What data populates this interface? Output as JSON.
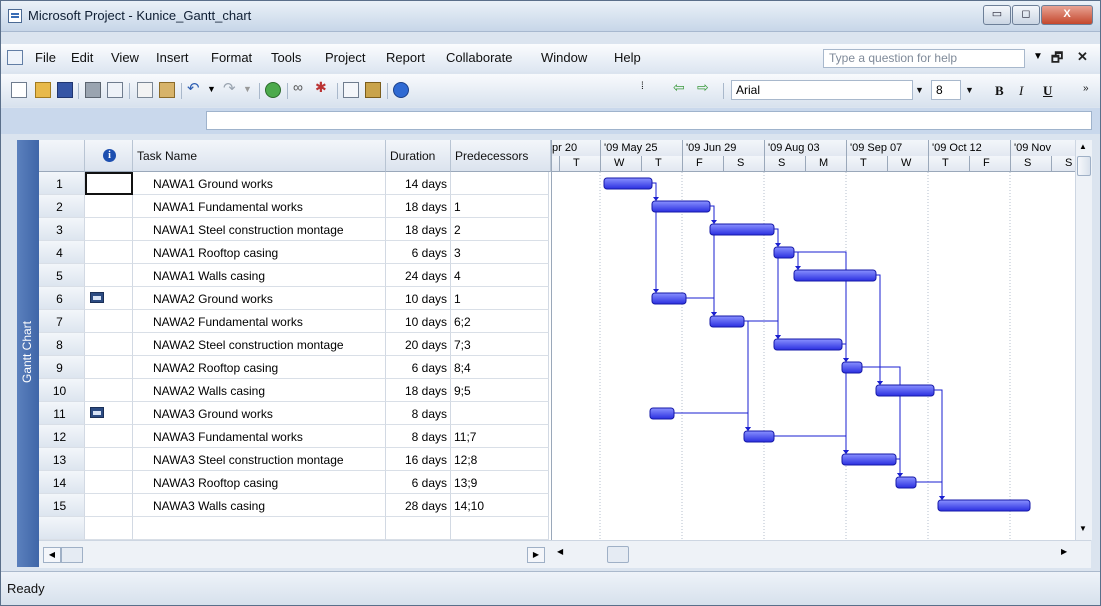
{
  "window": {
    "title": "Microsoft Project - Kunice_Gantt_chart",
    "minimize": "▭",
    "maximize": "◻",
    "close": "X"
  },
  "menu": {
    "items": [
      "File",
      "Edit",
      "View",
      "Insert",
      "Format",
      "Tools",
      "Project",
      "Report",
      "Collaborate",
      "Window",
      "Help"
    ],
    "help_placeholder": "Type a question for help"
  },
  "toolbar": {
    "font": "Arial",
    "font_size": "8",
    "bold": "B",
    "italic": "I",
    "underline": "U"
  },
  "viewbar": {
    "label": "Gantt Chart"
  },
  "table": {
    "columns": [
      "",
      "",
      "Task Name",
      "Duration",
      "Predecessors"
    ],
    "rows": [
      {
        "id": "1",
        "name": "NAWA1 Ground works",
        "duration": "14 days",
        "pred": "",
        "indicator": ""
      },
      {
        "id": "2",
        "name": "NAWA1 Fundamental works",
        "duration": "18 days",
        "pred": "1",
        "indicator": ""
      },
      {
        "id": "3",
        "name": "NAWA1 Steel construction montage",
        "duration": "18 days",
        "pred": "2",
        "indicator": ""
      },
      {
        "id": "4",
        "name": "NAWA1 Rooftop casing",
        "duration": "6 days",
        "pred": "3",
        "indicator": ""
      },
      {
        "id": "5",
        "name": "NAWA1 Walls casing",
        "duration": "24 days",
        "pred": "4",
        "indicator": ""
      },
      {
        "id": "6",
        "name": "NAWA2 Ground works",
        "duration": "10 days",
        "pred": "1",
        "indicator": "calendar-icon"
      },
      {
        "id": "7",
        "name": "NAWA2 Fundamental works",
        "duration": "10 days",
        "pred": "6;2",
        "indicator": ""
      },
      {
        "id": "8",
        "name": "NAWA2 Steel construction montage",
        "duration": "20 days",
        "pred": "7;3",
        "indicator": ""
      },
      {
        "id": "9",
        "name": "NAWA2 Rooftop casing",
        "duration": "6 days",
        "pred": "8;4",
        "indicator": ""
      },
      {
        "id": "10",
        "name": "NAWA2 Walls casing",
        "duration": "18 days",
        "pred": "9;5",
        "indicator": ""
      },
      {
        "id": "11",
        "name": "NAWA3 Ground works",
        "duration": "8 days",
        "pred": "",
        "indicator": "calendar-icon"
      },
      {
        "id": "12",
        "name": "NAWA3 Fundamental works",
        "duration": "8 days",
        "pred": "11;7",
        "indicator": ""
      },
      {
        "id": "13",
        "name": "NAWA3 Steel construction montage",
        "duration": "16 days",
        "pred": "12;8",
        "indicator": ""
      },
      {
        "id": "14",
        "name": "NAWA3 Rooftop casing",
        "duration": "6 days",
        "pred": "13;9",
        "indicator": ""
      },
      {
        "id": "15",
        "name": "NAWA3 Walls casing",
        "duration": "28 days",
        "pred": "14;10",
        "indicator": ""
      }
    ]
  },
  "gantt": {
    "weeks": [
      "pr 20",
      "'09 May 25",
      "'09 Jun 29",
      "'09 Aug 03",
      "'09 Sep 07",
      "'09 Oct 12",
      "'09 Nov"
    ],
    "days": [
      "T",
      "W",
      "T",
      "F",
      "S",
      "S",
      "M",
      "T",
      "W",
      "T",
      "F",
      "S",
      "S",
      "M"
    ]
  },
  "status": {
    "text": "Ready"
  },
  "colors": {
    "bar": "#3a3ef0",
    "viewbar": "#4a70b0"
  }
}
